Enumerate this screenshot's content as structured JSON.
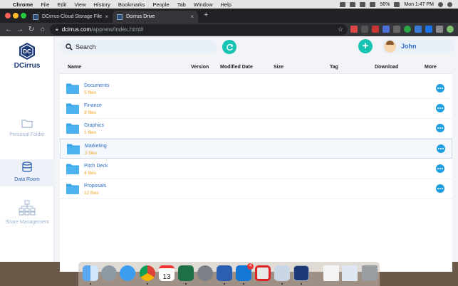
{
  "menubar": {
    "app_name": "Chrome",
    "items": [
      "File",
      "Edit",
      "View",
      "History",
      "Bookmarks",
      "People",
      "Tab",
      "Window",
      "Help"
    ],
    "battery": "56%",
    "clock": "Mon 1:47 PM"
  },
  "browser": {
    "tabs": [
      {
        "title": "DCirrus-Cloud Storage File"
      },
      {
        "title": "Dcirrus Drive"
      }
    ],
    "url_host": "dcirrus.com",
    "url_path": "/appnew/index.html#"
  },
  "sidebar": {
    "brand": "DCirrus",
    "items": [
      {
        "label": "Personal Folder",
        "icon": "folder-outline-icon",
        "active": false
      },
      {
        "label": "Data Room",
        "icon": "database-icon",
        "active": true
      },
      {
        "label": "Share Management",
        "icon": "org-chart-icon",
        "active": false
      }
    ]
  },
  "topbar": {
    "search_placeholder": "Search",
    "user_name": "John"
  },
  "table": {
    "headers": {
      "name": "Name",
      "version": "Version",
      "modified": "Modified Date",
      "size": "Size",
      "tag": "Tag",
      "download": "Download",
      "more": "More"
    },
    "rows": [
      {
        "name": "Documents",
        "count": "5 files",
        "selected": false
      },
      {
        "name": "Finance",
        "count": "9 files",
        "selected": false
      },
      {
        "name": "Graphics",
        "count": "1 files",
        "selected": false
      },
      {
        "name": "Marketing",
        "count": "3 files",
        "selected": true
      },
      {
        "name": "Pitch Deck",
        "count": "4 files",
        "selected": false
      },
      {
        "name": "Proposals",
        "count": "12 files",
        "selected": false
      }
    ]
  },
  "dock": {
    "calendar_day": "13",
    "outlook_badge": "4"
  },
  "colors": {
    "accent_teal": "#17c3b2",
    "link_blue": "#2b6cc4",
    "folder_blue": "#35a6ea",
    "count_orange": "#f0a020",
    "brand_navy": "#1c3a78"
  }
}
